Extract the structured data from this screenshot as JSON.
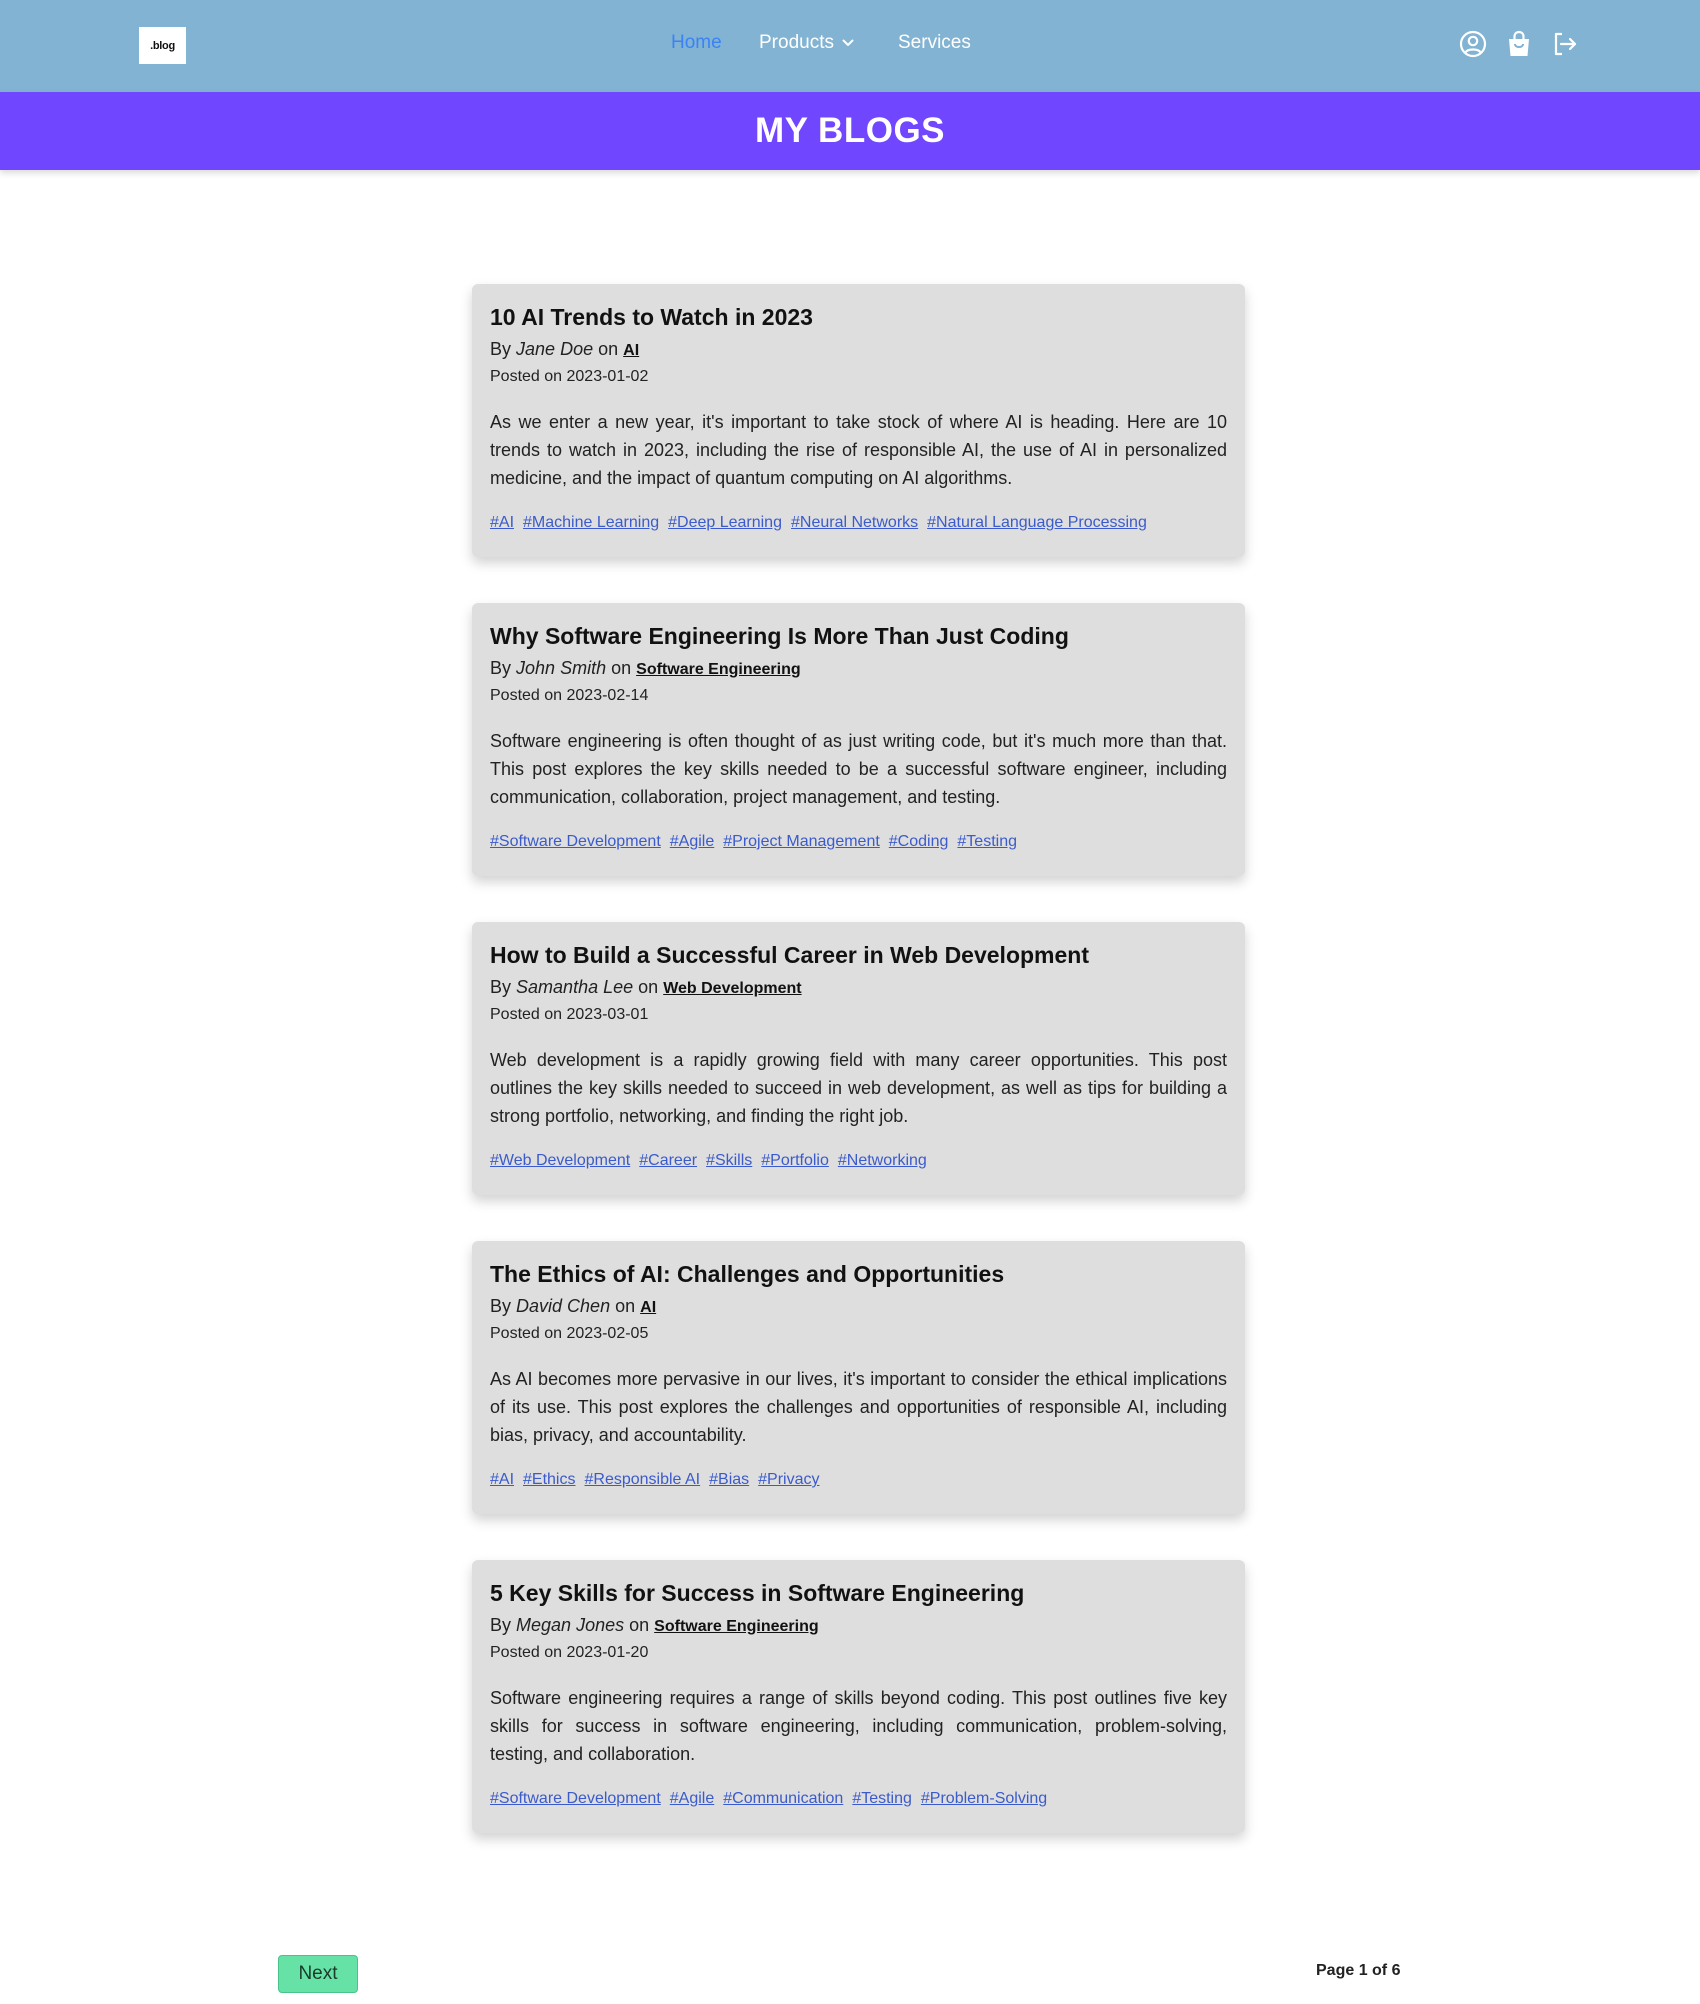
{
  "navbar": {
    "logo_text": ".blog",
    "links": [
      {
        "label": "Home",
        "active": true
      },
      {
        "label": "Products",
        "has_dropdown": true
      },
      {
        "label": "Services"
      }
    ],
    "icons": [
      "user-circle-icon",
      "shopping-bag-icon",
      "logout-icon"
    ],
    "background_color": "#82b3d2",
    "active_color": "#3b82f6"
  },
  "banner": {
    "title": "MY BLOGS",
    "background_color": "#7146ff"
  },
  "posts": [
    {
      "title": "10 AI Trends to Watch in 2023",
      "by": "By",
      "author": "Jane Doe",
      "on": "on",
      "category": "AI",
      "posted": "Posted on 2023-01-02",
      "excerpt": "As we enter a new year, it's important to take stock of where AI is heading. Here are 10 trends to watch in 2023, including the rise of responsible AI, the use of AI in personalized medicine, and the impact of quantum computing on AI algorithms.",
      "tags": [
        "#AI",
        "#Machine Learning",
        "#Deep Learning",
        "#Neural Networks",
        "#Natural Language Processing"
      ]
    },
    {
      "title": "Why Software Engineering Is More Than Just Coding",
      "by": "By",
      "author": "John Smith",
      "on": "on",
      "category": "Software Engineering",
      "posted": "Posted on 2023-02-14",
      "excerpt": "Software engineering is often thought of as just writing code, but it's much more than that. This post explores the key skills needed to be a successful software engineer, including communication, collaboration, project management, and testing.",
      "tags": [
        "#Software Development",
        "#Agile",
        "#Project Management",
        "#Coding",
        "#Testing"
      ]
    },
    {
      "title": "How to Build a Successful Career in Web Development",
      "by": "By",
      "author": "Samantha Lee",
      "on": "on",
      "category": "Web Development",
      "posted": "Posted on 2023-03-01",
      "excerpt": "Web development is a rapidly growing field with many career opportunities. This post outlines the key skills needed to succeed in web development, as well as tips for building a strong portfolio, networking, and finding the right job.",
      "tags": [
        "#Web Development",
        "#Career",
        "#Skills",
        "#Portfolio",
        "#Networking"
      ]
    },
    {
      "title": "The Ethics of AI: Challenges and Opportunities",
      "by": "By",
      "author": "David Chen",
      "on": "on",
      "category": "AI",
      "posted": "Posted on 2023-02-05",
      "excerpt": "As AI becomes more pervasive in our lives, it's important to consider the ethical implications of its use. This post explores the challenges and opportunities of responsible AI, including bias, privacy, and accountability.",
      "tags": [
        "#AI",
        "#Ethics",
        "#Responsible AI",
        "#Bias",
        "#Privacy"
      ]
    },
    {
      "title": "5 Key Skills for Success in Software Engineering",
      "by": "By",
      "author": "Megan Jones",
      "on": "on",
      "category": "Software Engineering",
      "posted": "Posted on 2023-01-20",
      "excerpt": "Software engineering requires a range of skills beyond coding. This post outlines five key skills for success in software engineering, including communication, problem-solving, testing, and collaboration.",
      "tags": [
        "#Software Development",
        "#Agile",
        "#Communication",
        "#Testing",
        "#Problem-Solving"
      ]
    }
  ],
  "pagination": {
    "next_label": "Next",
    "page_info": "Page 1 of 6",
    "next_color": "#67e2a6"
  }
}
